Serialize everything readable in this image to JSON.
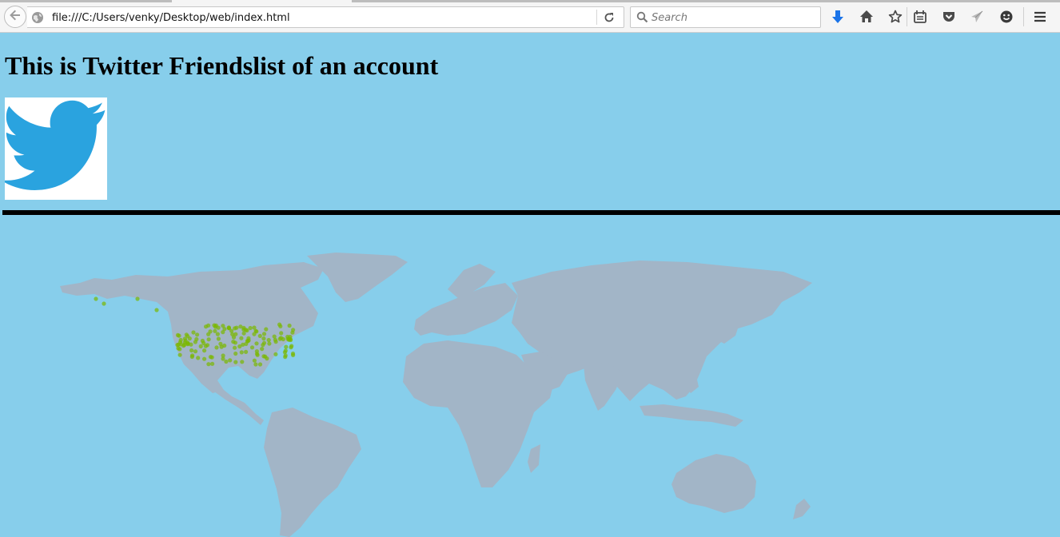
{
  "browser": {
    "url": "file:///C:/Users/venky/Desktop/web/index.html",
    "search_placeholder": "Search",
    "icons": [
      "back-icon",
      "globe-icon",
      "reload-icon",
      "search-icon",
      "download-icon",
      "home-icon",
      "bookmark-star-icon",
      "reading-list-icon",
      "pocket-icon",
      "send-icon",
      "smiley-icon",
      "menu-icon"
    ],
    "download_color": "#1a73e8"
  },
  "page": {
    "title": "This is Twitter Friendslist of an account",
    "background": "#87ceeb",
    "logo_color": "#2aa3df",
    "map_land_color": "#a2b5c7",
    "dot_color": "#7ab800"
  }
}
